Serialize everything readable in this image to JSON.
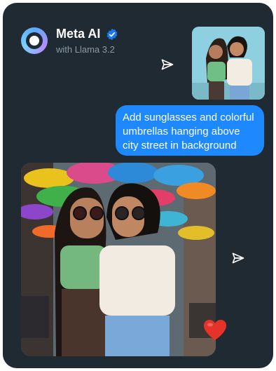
{
  "header": {
    "title": "Meta AI",
    "subtitle": "with Llama 3.2"
  },
  "messages": {
    "user_prompt": "Add sunglasses and colorful umbrellas hanging above city street in background"
  },
  "icons": {
    "avatar": "meta-ai-ring-icon",
    "verified": "verified-check-icon",
    "send": "paper-plane-icon",
    "reaction": "heart-icon"
  },
  "colors": {
    "background": "#1f2a33",
    "bubble": "#1e88ff",
    "heart": "#e5332a",
    "verified": "#1877f2"
  }
}
